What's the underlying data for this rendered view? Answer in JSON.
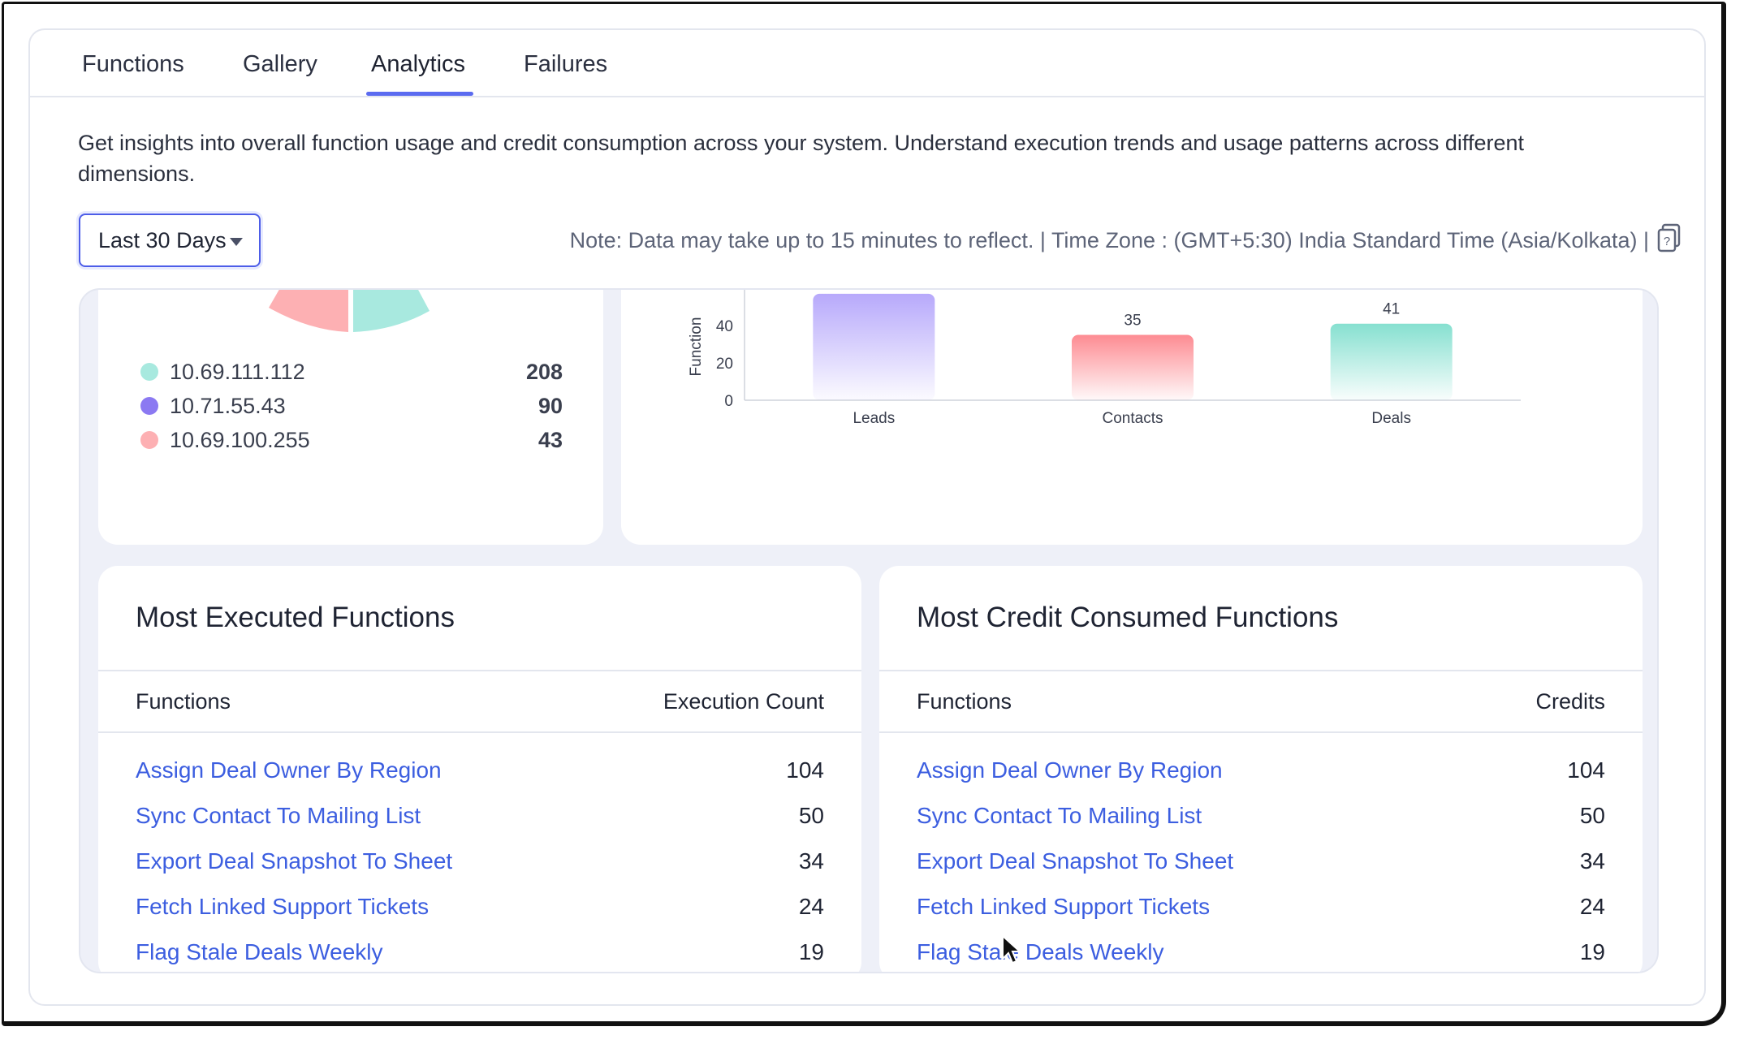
{
  "tabs": [
    {
      "label": "Functions"
    },
    {
      "label": "Gallery"
    },
    {
      "label": "Analytics"
    },
    {
      "label": "Failures"
    }
  ],
  "active_tab": "Analytics",
  "intro": "Get insights into overall function usage and credit consumption across your system. Understand execution trends and usage patterns across different dimensions.",
  "date_range": {
    "selected": "Last 30 Days"
  },
  "note": "Note: Data may take up to 15 minutes to reflect. | Time Zone : (GMT+5:30) India Standard Time (Asia/Kolkata) |",
  "ip_legend": [
    {
      "label": "10.69.111.112",
      "value": "208",
      "color": "#a8e9df"
    },
    {
      "label": "10.71.55.43",
      "value": "90",
      "color": "#8b79f2"
    },
    {
      "label": "10.69.100.255",
      "value": "43",
      "color": "#fdb0b3"
    }
  ],
  "chart_data": {
    "type": "bar",
    "ylabel": "Function",
    "categories": [
      "Leads",
      "Contacts",
      "Deals"
    ],
    "values": [
      null,
      35,
      41
    ],
    "data_labels": [
      "",
      "35",
      "41"
    ],
    "yticks": [
      "0",
      "20",
      "40"
    ],
    "ylim": [
      0,
      57
    ],
    "colors": [
      "#b7a9fb",
      "#fd8b92",
      "#86e0d0"
    ]
  },
  "most_executed": {
    "title": "Most Executed Functions",
    "col_name": "Functions",
    "col_value": "Execution Count",
    "rows": [
      {
        "name": "Assign Deal Owner By Region",
        "value": "104"
      },
      {
        "name": "Sync Contact To Mailing List",
        "value": "50"
      },
      {
        "name": "Export Deal Snapshot To Sheet",
        "value": "34"
      },
      {
        "name": "Fetch Linked Support Tickets",
        "value": "24"
      },
      {
        "name": "Flag Stale Deals Weekly",
        "value": "19"
      }
    ]
  },
  "most_credit": {
    "title": "Most Credit Consumed Functions",
    "col_name": "Functions",
    "col_value": "Credits",
    "rows": [
      {
        "name": "Assign Deal Owner By Region",
        "value": "104"
      },
      {
        "name": "Sync Contact To Mailing List",
        "value": "50"
      },
      {
        "name": "Export Deal Snapshot To Sheet",
        "value": "34"
      },
      {
        "name": "Fetch Linked Support Tickets",
        "value": "24"
      },
      {
        "name": "Flag Stale Deals Weekly",
        "value": "19"
      }
    ]
  }
}
